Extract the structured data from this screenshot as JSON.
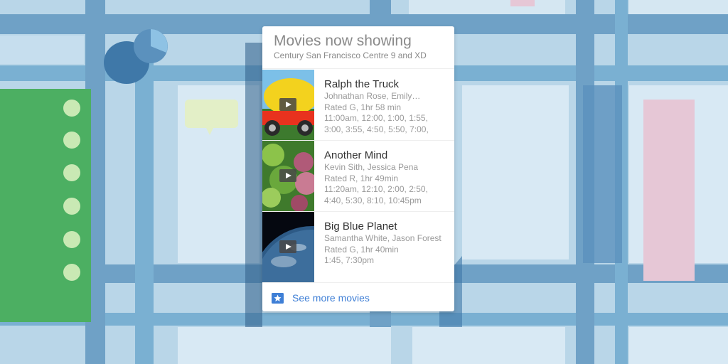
{
  "card": {
    "title": "Movies now showing",
    "subtitle": "Century San Francisco Centre 9 and XD"
  },
  "movies": [
    {
      "title": "Ralph the Truck",
      "cast": "Johnathan Rose, Emily…",
      "rating": "Rated G, 1hr 58 min",
      "times_line1": "11:00am, 12:00, 1:00, 1:55,",
      "times_line2": "3:00, 3:55, 4:50, 5:50, 7:00,",
      "poster_icon": "truck-poster"
    },
    {
      "title": "Another Mind",
      "cast": "Kevin Sith, Jessica Pena",
      "rating": "Rated R, 1hr 49min",
      "times_line1": "11:20am, 12:10, 2:00, 2:50,",
      "times_line2": "4:40, 5:30, 8:10, 10:45pm",
      "poster_icon": "plant-poster"
    },
    {
      "title": "Big Blue Planet",
      "cast": "Samantha White, Jason Forest",
      "rating": "Rated G, 1hr 40min",
      "times_line1": "1:45, 7:30pm",
      "times_line2": "",
      "poster_icon": "planet-poster"
    }
  ],
  "footer": {
    "label": "See more movies",
    "icon": "star-ticket-icon"
  },
  "colors": {
    "link": "#3f7fd6",
    "map_background": "#b9d6e8",
    "park": "#4caf62"
  }
}
